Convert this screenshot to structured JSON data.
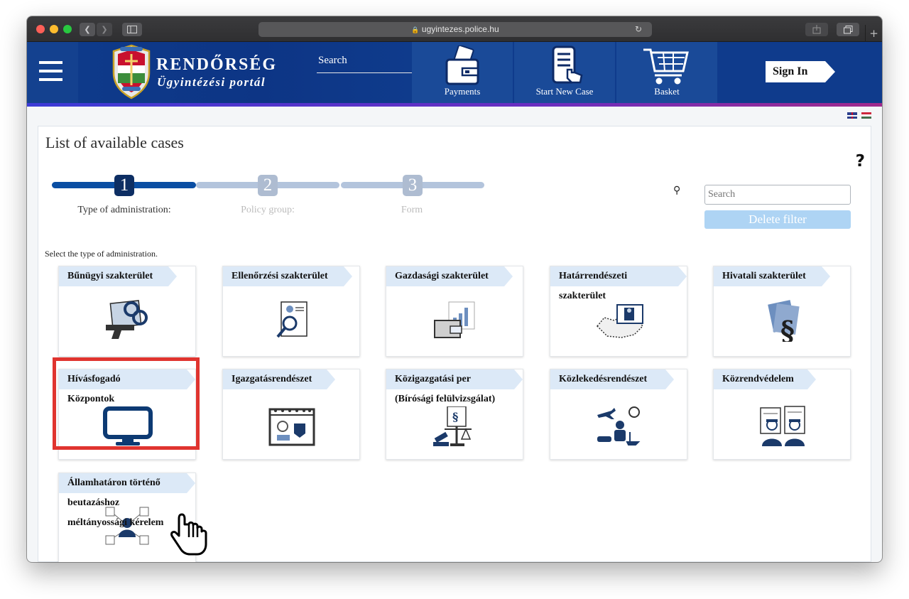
{
  "browser": {
    "url": "ugyintezes.police.hu",
    "lock_icon": "lock-icon"
  },
  "header": {
    "brand_line1": "RENDŐRSÉG",
    "brand_line2": "Ügyintézési portál",
    "search_placeholder": "Search",
    "nav": [
      {
        "label": "Payments",
        "icon": "wallet-icon"
      },
      {
        "label": "Start New Case",
        "icon": "document-hand-icon"
      },
      {
        "label": "Basket",
        "icon": "cart-icon"
      }
    ],
    "signin_label": "Sign In",
    "colors": {
      "header_bg": "#0f3b8c",
      "tile_bg": "#1a4a98",
      "stripe": "#6a2ec0"
    }
  },
  "main": {
    "title": "List of available cases",
    "help_label": "?",
    "steps": [
      {
        "number": "1",
        "label": "Type of administration:",
        "state": "active"
      },
      {
        "number": "2",
        "label": "Policy group:",
        "state": "inactive"
      },
      {
        "number": "3",
        "label": "Form",
        "state": "inactive"
      }
    ],
    "search_placeholder": "Search",
    "delete_filter_label": "Delete filter",
    "instruction": "Select the type of administration.",
    "cards": [
      {
        "line1": "Bűnügyi szakterület",
        "line2": "",
        "line3": "",
        "icon": "handcuffs-pistol-icon"
      },
      {
        "line1": "Ellenőrzési szakterület",
        "line2": "",
        "line3": "",
        "icon": "document-magnifier-icon"
      },
      {
        "line1": "Gazdasági szakterület",
        "line2": "",
        "line3": "",
        "icon": "wallet-chart-icon"
      },
      {
        "line1": "Határrendészeti",
        "line2": "szakterület",
        "line3": "",
        "icon": "border-map-icon"
      },
      {
        "line1": "Hivatali szakterület",
        "line2": "",
        "line3": "",
        "icon": "paragraph-documents-icon"
      },
      {
        "line1": "Hívásfogadó",
        "line2": "Központok",
        "line3": "",
        "icon": "monitor-icon"
      },
      {
        "line1": "Igazgatásrendészet",
        "line2": "",
        "line3": "",
        "icon": "calendar-badge-icon"
      },
      {
        "line1": "Közigazgatási per",
        "line2": "(Bírósági felülvizsgálat)",
        "line3": "",
        "icon": "scales-gavel-icon"
      },
      {
        "line1": "Közlekedésrendészet",
        "line2": "",
        "line3": "",
        "icon": "traffic-icon"
      },
      {
        "line1": "Közrendvédelem",
        "line2": "",
        "line3": "",
        "icon": "officers-icon"
      },
      {
        "line1": "Államhatáron történő",
        "line2": "beutazáshoz",
        "line3": "méltányossági kérelem",
        "icon": "officer-network-icon"
      }
    ]
  },
  "cursor": {
    "icon": "hand-pointer-icon"
  }
}
